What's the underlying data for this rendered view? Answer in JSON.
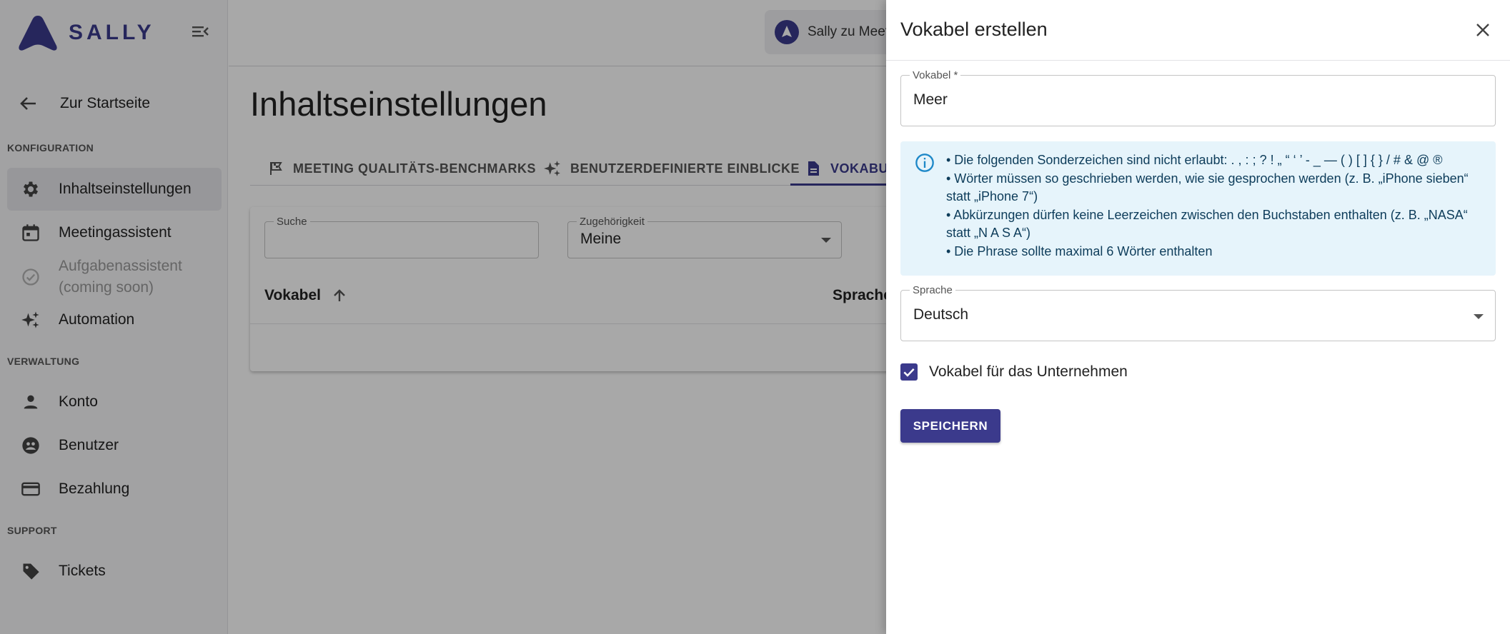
{
  "sidebar": {
    "logo_text": "SALLY",
    "back_label": "Zur Startseite",
    "sections": {
      "konfiguration": "KONFIGURATION",
      "verwaltung": "VERWALTUNG",
      "support": "SUPPORT"
    },
    "items": [
      {
        "label": "Inhaltseinstellungen",
        "icon": "gear-icon"
      },
      {
        "label": "Meetingassistent",
        "icon": "calendar-icon"
      },
      {
        "label": "Aufgabenassistent (coming soon)",
        "icon": "check-circle-icon"
      },
      {
        "label": "Automation",
        "icon": "sparkles-icon"
      },
      {
        "label": "Konto",
        "icon": "person-icon"
      },
      {
        "label": "Benutzer",
        "icon": "users-icon"
      },
      {
        "label": "Bezahlung",
        "icon": "credit-card-icon"
      },
      {
        "label": "Tickets",
        "icon": "tag-icon"
      }
    ]
  },
  "topbar": {
    "org_label": "Sally zu Meet"
  },
  "main": {
    "title": "Inhaltseinstellungen",
    "tabs": [
      {
        "label": "MEETING QUALITÄTS-BENCHMARKS",
        "icon": "flag-icon"
      },
      {
        "label": "BENUTZERDEFINIERTE EINBLICKE",
        "icon": "sparkles-icon"
      },
      {
        "label": "VOKABU",
        "icon": "document-icon"
      }
    ],
    "filters": {
      "search_label": "Suche",
      "search_value": "",
      "scope_label": "Zugehörigkeit",
      "scope_value": "Meine"
    },
    "table": {
      "col_vocab": "Vokabel",
      "col_language": "Sprache"
    }
  },
  "drawer": {
    "title": "Vokabel erstellen",
    "vocab_label": "Vokabel *",
    "vocab_value": "Meer",
    "info_lines": [
      "• Die folgenden Sonderzeichen sind nicht erlaubt: . , : ; ? ! „ “ ‘ ’ - _ — ( ) [ ] { } / # & @ ®",
      "• Wörter müssen so geschrieben werden, wie sie gesprochen werden (z. B. „iPhone sieben“",
      "statt „iPhone 7“)",
      "• Abkürzungen dürfen keine Leerzeichen zwischen den Buchstaben enthalten (z. B. „NASA“",
      "statt „N A S A“)",
      "• Die Phrase sollte maximal 6 Wörter enthalten"
    ],
    "language_label": "Sprache",
    "language_value": "Deutsch",
    "company_checkbox_label": "Vokabel für das Unternehmen",
    "company_checkbox_checked": true,
    "save_label": "SPEICHERN"
  },
  "colors": {
    "brand": "#3b3a8c",
    "info_bg": "#e6f4fb",
    "info_icon": "#1e88c8"
  }
}
